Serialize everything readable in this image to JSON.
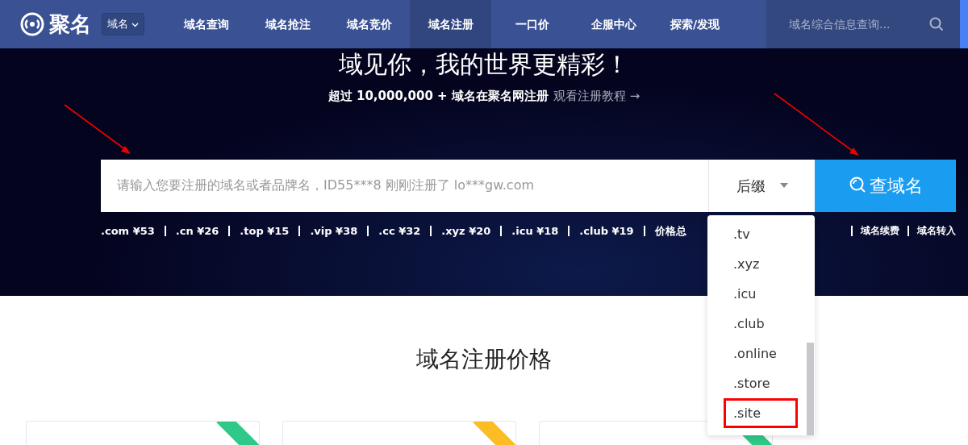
{
  "header": {
    "logo": "聚名",
    "scope_select": "域名",
    "nav": [
      {
        "label": "域名查询",
        "selected": false
      },
      {
        "label": "域名抢注",
        "selected": false
      },
      {
        "label": "域名竞价",
        "selected": false
      },
      {
        "label": "域名注册",
        "selected": true
      },
      {
        "label": "一口价",
        "selected": false
      },
      {
        "label": "企服中心",
        "selected": false
      },
      {
        "label": "探索/发现",
        "selected": false
      }
    ],
    "search": {
      "placeholder": "域名综合信息查询..."
    }
  },
  "hero": {
    "title": "域见你，我的世界更精彩！",
    "subtitle": "超过 10,000,000 + 域名在聚名网注册",
    "tutorial_link": "观看注册教程 →",
    "search": {
      "placeholder": "请输入您要注册的域名或者品牌名，ID55***8 刚刚注册了 lo***gw.com",
      "suffix_label": "后缀",
      "button": "查域名"
    },
    "quick_links": [
      ".com ¥53",
      ".cn ¥26",
      ".top ¥15",
      ".vip ¥38",
      ".cc ¥32",
      ".xyz ¥20",
      ".icu ¥18",
      ".club ¥19",
      "价格总",
      "域名续费",
      "域名转入"
    ]
  },
  "suffix_dropdown": {
    "options": [
      {
        "label": ".tv",
        "highlighted": false
      },
      {
        "label": ".xyz",
        "highlighted": false
      },
      {
        "label": ".icu",
        "highlighted": false
      },
      {
        "label": ".club",
        "highlighted": false
      },
      {
        "label": ".online",
        "highlighted": false
      },
      {
        "label": ".store",
        "highlighted": false
      },
      {
        "label": ".site",
        "highlighted": true
      }
    ]
  },
  "pricing": {
    "title": "域名注册价格",
    "cards": [
      {
        "color": "#2ec989"
      },
      {
        "color": "#fbbd23"
      },
      {
        "color": "#2ec989"
      }
    ]
  }
}
